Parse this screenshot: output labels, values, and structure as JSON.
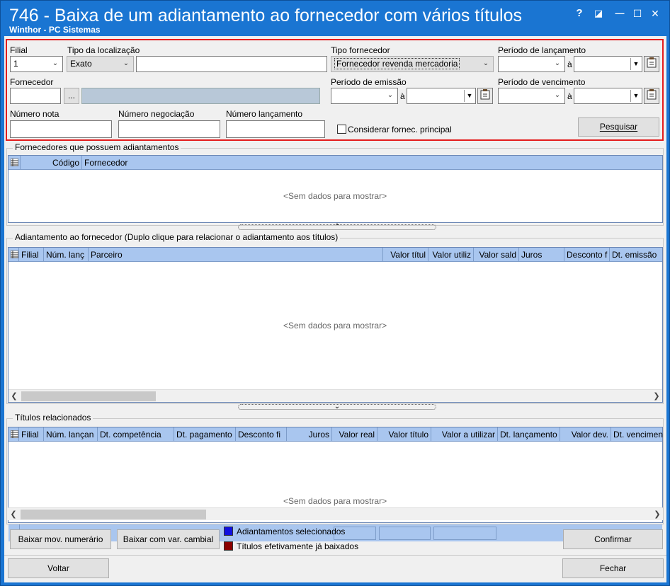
{
  "window": {
    "title": "746 - Baixa de um adiantamento ao fornecedor com vários títulos",
    "subtitle": "Winthor - PC Sistemas",
    "help_glyph": "?",
    "restore_glyph": "◪",
    "minimize_glyph": "—",
    "maximize_glyph": "☐",
    "close_glyph": "✕"
  },
  "filters": {
    "filial_label": "Filial",
    "filial_value": "1",
    "tipo_localizacao_label": "Tipo da localização",
    "tipo_localizacao_value": "Exato",
    "localizacao_value": "",
    "tipo_fornecedor_label": "Tipo fornecedor",
    "tipo_fornecedor_value": "Fornecedor revenda mercadoria",
    "periodo_lancamento_label": "Período de lançamento",
    "fornecedor_label": "Fornecedor",
    "fornecedor_lookup_label": "...",
    "periodo_emissao_label": "Período de emissão",
    "periodo_vencimento_label": "Período de vencimento",
    "range_sep": "à",
    "numero_nota_label": "Número nota",
    "numero_negociacao_label": "Número negociação",
    "numero_lancamento_label": "Número lançamento",
    "considerar_label": "Considerar fornec. principal",
    "pesquisar_label": "Pesquisar"
  },
  "grid_fornecedores": {
    "title": "Fornecedores que possuem adiantamentos",
    "columns": [
      "Código",
      "Fornecedor"
    ],
    "empty": "<Sem dados para mostrar>"
  },
  "grid_adiantamento": {
    "title": "Adiantamento ao fornecedor (Duplo clique para relacionar o adiantamento aos títulos)",
    "columns": [
      "Filial",
      "Núm. lanç",
      "Parceiro",
      "Valor títul",
      "Valor utiliz",
      "Valor sald",
      "Juros",
      "Desconto f",
      "Dt. emissão"
    ],
    "empty": "<Sem dados para mostrar>"
  },
  "grid_titulos": {
    "title": "Títulos relacionados",
    "columns": [
      "Filial",
      "Núm. lançan",
      "Dt. competência",
      "Dt. pagamento",
      "Desconto fi",
      "Juros",
      "Valor real",
      "Valor título",
      "Valor a utilizar",
      "Dt. lançamento",
      "Valor dev.",
      "Dt. vencimen"
    ],
    "empty": "<Sem dados para mostrar>"
  },
  "footer": {
    "baixar_mov_label": "Baixar mov. numerário",
    "baixar_var_label": "Baixar com var. cambial",
    "legend_selecionados": "Adiantamentos selecionados",
    "legend_baixados": "Títulos efetivamente já baixados",
    "confirmar_label": "Confirmar",
    "voltar_label": "Voltar",
    "fechar_label": "Fechar"
  },
  "colors": {
    "titlebar": "#1a75d2",
    "highlight_border": "#e41c1c",
    "legend_blue": "#1010e0",
    "legend_red": "#8b0000",
    "grid_header": "#a9c6ef"
  }
}
